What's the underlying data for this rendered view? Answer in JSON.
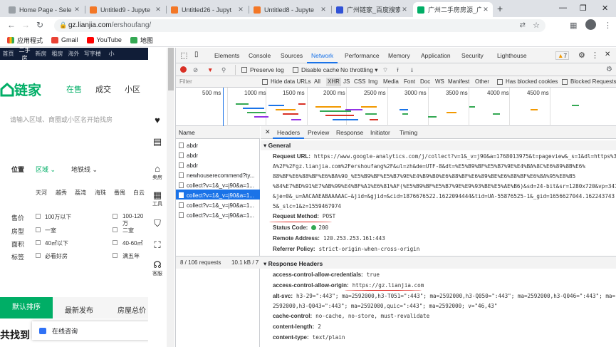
{
  "browser": {
    "tabs": [
      {
        "title": "Home Page - Sele",
        "color": "#5f6368"
      },
      {
        "title": "Untitled9 - Jupyte",
        "color": "#f37726"
      },
      {
        "title": "Untitled26 - Jupyt",
        "color": "#f37726"
      },
      {
        "title": "Untitled8 - Jupyte",
        "color": "#f37726"
      },
      {
        "title": "广州链家_百度搜索",
        "color": "#3052d6"
      },
      {
        "title": "广州二手房房源_广",
        "color": "#00ae66"
      }
    ],
    "new_tab": "+",
    "url_host": "gz.lianjia.com",
    "url_path": "/ershoufang/",
    "bookmarks": [
      "应用程式",
      "Gmail",
      "YouTube",
      "地图"
    ]
  },
  "page": {
    "topnav": [
      "首页",
      "二手房",
      "新房",
      "租房",
      "海外",
      "写字楼",
      "小"
    ],
    "logo": "链家",
    "nav": [
      "在售",
      "成交",
      "小区"
    ],
    "search_placeholder": "请输入区域、商圈或小区名开始找房",
    "pos_label": "位置",
    "pos_tabs": [
      "区域",
      "地铁线"
    ],
    "districts": [
      "天河",
      "越秀",
      "荔湾",
      "海珠",
      "番禺",
      "白云"
    ],
    "price_label": "售价",
    "price1": "100万以下",
    "price2": "100-120万",
    "type_label": "房型",
    "type1": "一室",
    "type2": "二室",
    "area_label": "面积",
    "area1": "40㎡以下",
    "area2": "40-60㎡",
    "tag_label": "标签",
    "tag1": "必看好房",
    "tag2": "满五年",
    "sort": [
      "默认排序",
      "最新发布",
      "房屋总价"
    ],
    "bottom_title": "共找到",
    "chat": "在线咨询",
    "side_tools": [
      "",
      "",
      "卖房",
      "工具",
      "",
      "",
      "客服"
    ]
  },
  "devtools": {
    "tabs": [
      "Elements",
      "Console",
      "Sources",
      "Network",
      "Performance",
      "Memory",
      "Application",
      "Security",
      "Lighthouse"
    ],
    "active_tab": "Network",
    "warn_count": "7",
    "preserve_log": "Preserve log",
    "disable_cache": "Disable cache",
    "throttling": "No throttling",
    "filter_placeholder": "Filter",
    "hide_data_urls": "Hide data URLs",
    "types": [
      "All",
      "XHR",
      "JS",
      "CSS",
      "Img",
      "Media",
      "Font",
      "Doc",
      "WS",
      "Manifest",
      "Other"
    ],
    "has_blocked_cookies": "Has blocked cookies",
    "blocked_requests": "Blocked Requests",
    "ticks": [
      "500 ms",
      "1000 ms",
      "1500 ms",
      "2000 ms",
      "2500 ms",
      "3000 ms",
      "3500 ms",
      "4000 ms",
      "4500 ms"
    ],
    "name_header": "Name",
    "requests": [
      "abdr",
      "abdr",
      "abdr",
      "newhouserecommend?ty...",
      "collect?v=1&_v=j90&a=1...",
      "collect?v=1&_v=j90&a=1...",
      "collect?v=1&_v=j90&a=1...",
      "collect?v=1&_v=j90&a=1..."
    ],
    "selected_index": 5,
    "status_requests": "8 / 106 requests",
    "status_size": "10.1 kB / 7",
    "detail_tabs": [
      "Headers",
      "Preview",
      "Response",
      "Initiator",
      "Timing"
    ],
    "general_title": "General",
    "request_url_label": "Request URL:",
    "request_url_lines": [
      "https://www.google-analytics.com/j/collect?v=1&_v=j90&a=1768013975&t=pageview&_s=1&dl=https%3",
      "A%2F%2Fgz.lianjia.com%2Fershoufang%2F&ul=zh&de=UTF-8&dt=%E5%B9%BF%E5%B7%9E%E4%BA%8C%E6%89%8B%E6%",
      "88%BF%E6%88%BF%E6%BA%90_%E5%B9%BF%E5%B7%9E%E4%B9%B0%E6%88%BF%E6%89%BE%E6%88%BF%E6%8A%95%E8%B5",
      "%84%E7%BD%91%E7%AB%99%E4%BF%A1%E6%81%AF(%E5%B9%BF%E5%B7%9E%E9%93%BE%E5%AE%B6)&sd=24-bit&sr=1280x720&vp=347x599",
      "&je=0&_u=AACAAEABAAAAAC~&jid=&gjid=&cid=1876676522.1622094444&tid=UA-55876525-1&_gid=1656627044.162243743",
      "5&_slc=1&z=1559467974"
    ],
    "request_method_label": "Request Method:",
    "request_method": "POST",
    "status_code_label": "Status Code:",
    "status_code": "200",
    "remote_label": "Remote Address:",
    "remote_address": "120.253.253.161:443",
    "referrer_label": "Referrer Policy:",
    "referrer_policy": "strict-origin-when-cross-origin",
    "response_headers_title": "Response Headers",
    "acac_label": "access-control-allow-credentials:",
    "acac": "true",
    "acao_label": "access-control-allow-origin:",
    "acao": "https://gz.lianjia.com",
    "altsvc_label": "alt-svc:",
    "altsvc_lines": [
      "h3-29=\":443\"; ma=2592000,h3-T051=\":443\"; ma=2592000,h3-Q050=\":443\"; ma=2592000,h3-Q046=\":443\"; ma=",
      "2592000,h3-Q043=\":443\"; ma=2592000,quic=\":443\"; ma=2592000; v=\"46,43\""
    ],
    "cache_label": "cache-control:",
    "cache": "no-cache, no-store, must-revalidate",
    "clen_label": "content-length:",
    "clen": "2",
    "ctype_label": "content-type:",
    "ctype": "text/plain"
  },
  "colors": {
    "accent": "#1a73e8",
    "brand": "#00ae66",
    "annotation": "#e1221c"
  }
}
